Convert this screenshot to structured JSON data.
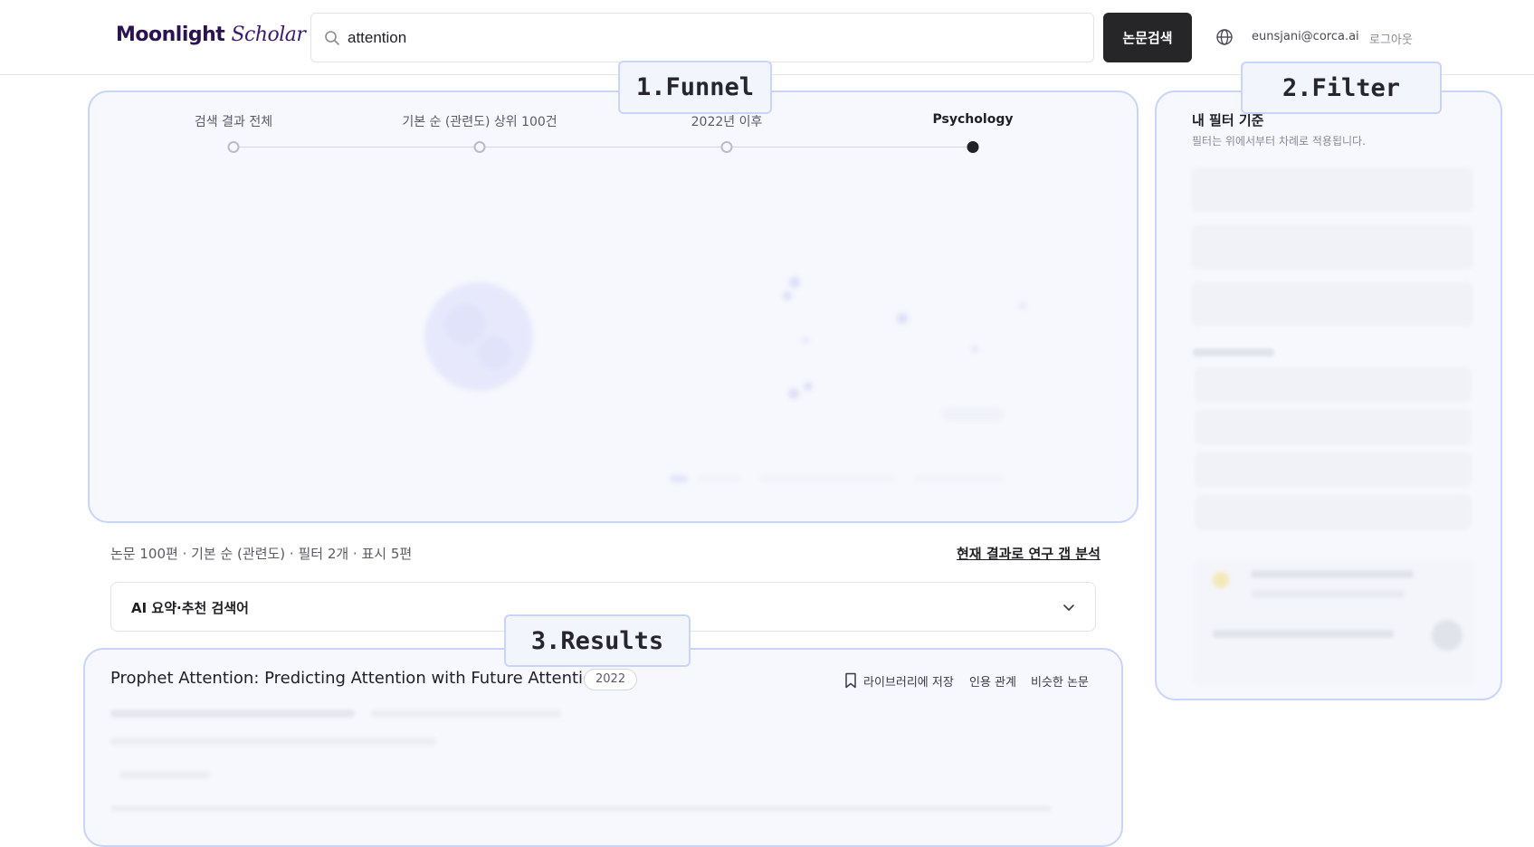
{
  "header": {
    "logo_bold": "Moonlight",
    "logo_italic": "Scholar",
    "search_value": "attention",
    "search_button": "논문검색",
    "user_email": "eunsjani@corca.ai",
    "logout": "로그아웃"
  },
  "funnel": {
    "steps": [
      {
        "label": "검색 결과 전체",
        "active": false
      },
      {
        "label": "기본 순 (관련도) 상위 100건",
        "active": false
      },
      {
        "label": "2022년 이후",
        "active": false
      },
      {
        "label": "Psychology",
        "active": true
      }
    ],
    "overlay": "1.Funnel"
  },
  "filter": {
    "title": "내 필터 기준",
    "subtitle": "필터는 위에서부터 차례로 적용됩니다.",
    "overlay": "2.Filter"
  },
  "results": {
    "summary": "논문 100편 · 기본 순 (관련도) · 필터 2개 · 표시 5편",
    "gap_link": "현재 결과로 연구 갭 분석",
    "ai_label": "AI 요약·추천 검색어",
    "overlay": "3.Results",
    "paper": {
      "title": "Prophet Attention: Predicting Attention with Future Attention",
      "year": "2022",
      "actions": {
        "save": "라이브러리에 저장",
        "citation": "인용 관계",
        "similar": "비슷한 논문"
      }
    }
  },
  "colors": {
    "accent_border": "#c9d4fb",
    "panel_bg": "#f7f8fd",
    "logo": "#2a1350",
    "button_bg": "#262628"
  },
  "icons": {
    "search": "search-icon",
    "globe": "globe-icon",
    "chevron": "chevron-down-icon",
    "bookmark": "bookmark-icon"
  }
}
